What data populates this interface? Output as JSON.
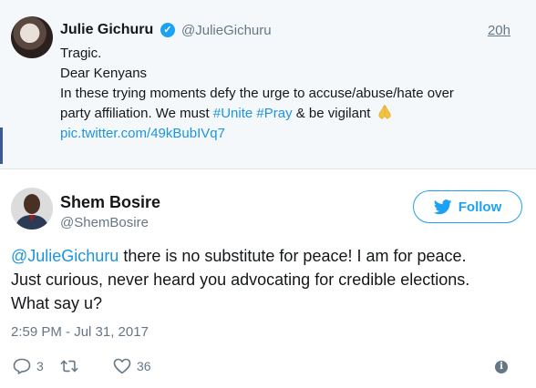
{
  "parent_tweet": {
    "name": "Julie Gichuru",
    "handle": "@JulieGichuru",
    "time": "20h",
    "text_lines": {
      "l1": "Tragic.",
      "l2": "Dear Kenyans",
      "l3": "In these trying moments defy the urge to accuse/abuse/hate over",
      "l4_prefix": "party affiliation. We must ",
      "l4_hashtag1": "#Unite",
      "l4_space": " ",
      "l4_hashtag2": "#Pray",
      "l4_suffix": " & be vigilant",
      "l5_link": "pic.twitter.com/49kBubIVq7"
    },
    "emoji": "pray-icon",
    "verified_icon": "verified-badge-icon"
  },
  "main_tweet": {
    "name": "Shem Bosire",
    "handle": "@ShemBosire",
    "follow_label": "Follow",
    "text_mention": "@JulieGichuru",
    "text_line1_rest": " there is no substitute for peace! I am for peace.",
    "text_line2": "Just curious, never heard you advocating for credible elections.",
    "text_line3": "What say u?",
    "date": "2:59 PM - Jul 31, 2017",
    "actions": {
      "reply_count": "3",
      "retweet_count": "",
      "like_count": "36"
    }
  },
  "colors": {
    "accent": "#1da1f2",
    "link": "#1b95e0",
    "muted": "#657786",
    "parent_bg": "#f5f8fa"
  }
}
